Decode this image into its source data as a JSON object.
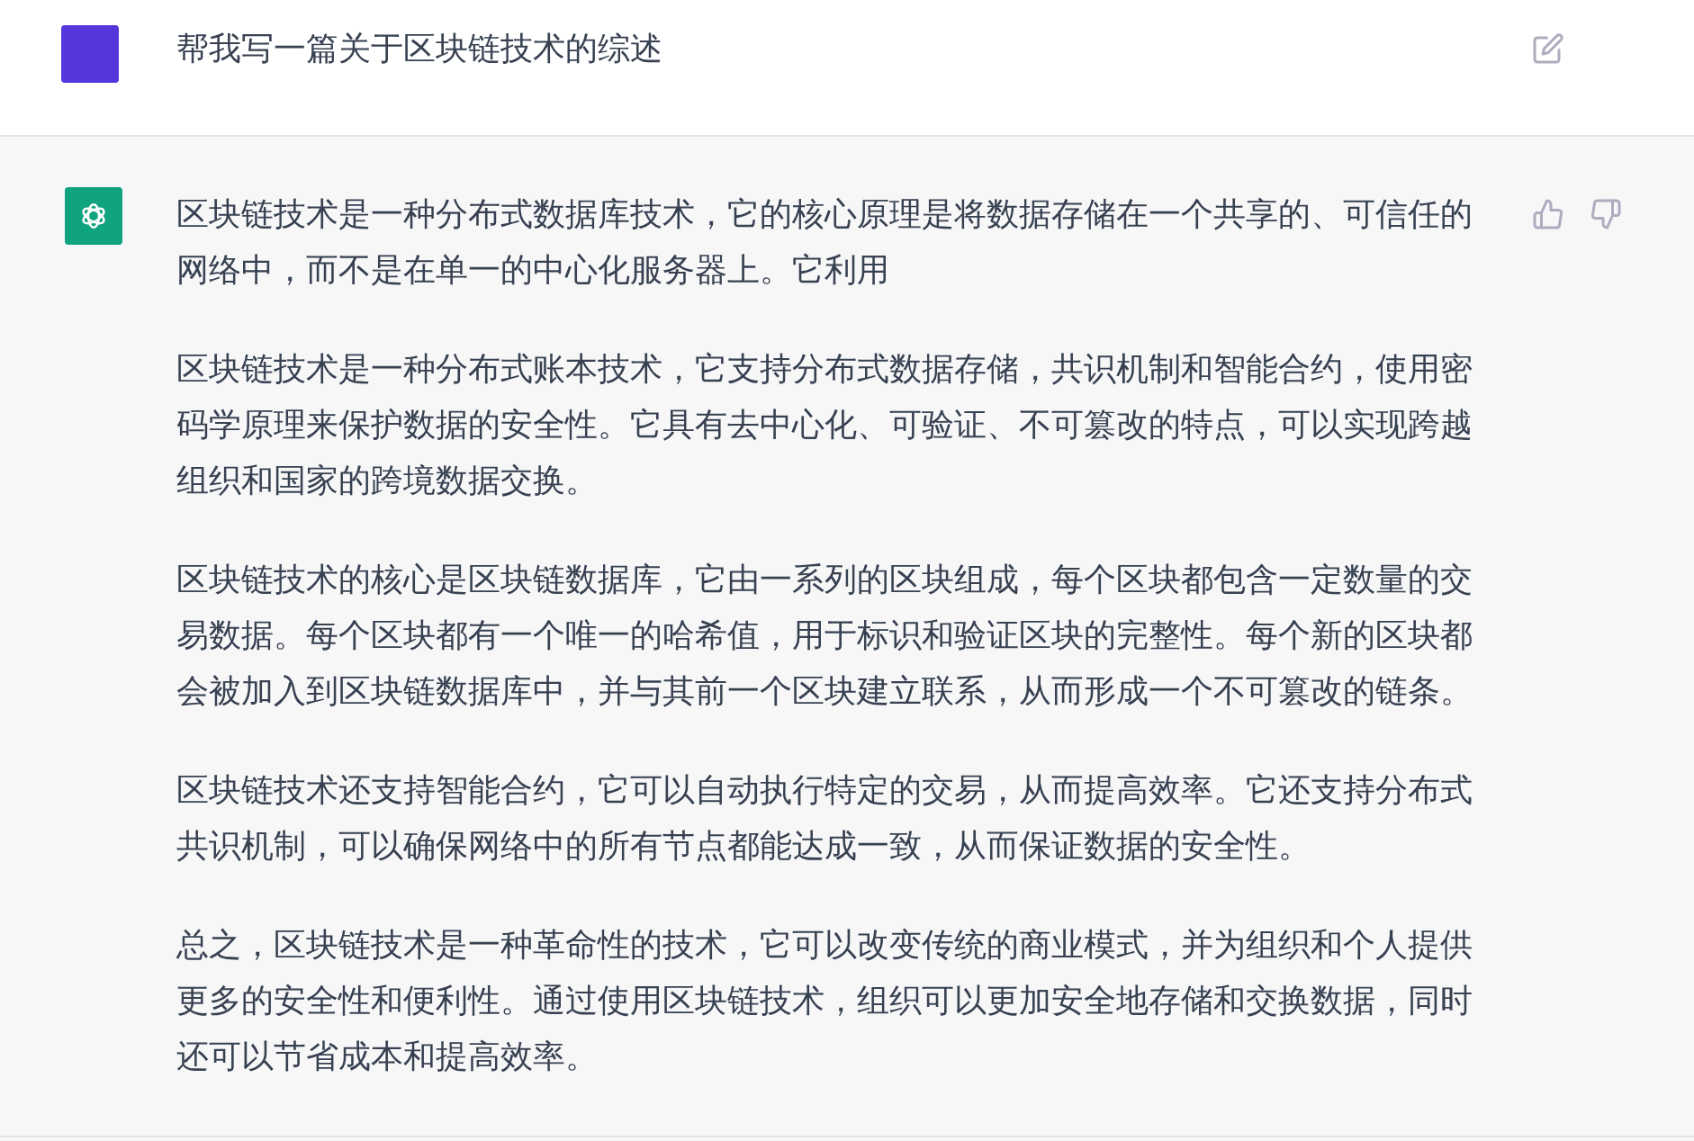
{
  "messages": [
    {
      "kind": "user",
      "paragraphs": [
        "帮我写一篇关于区块链技术的综述"
      ]
    },
    {
      "kind": "assistant",
      "paragraphs": [
        "区块链技术是一种分布式数据库技术，它的核心原理是将数据存储在一个共享的、可信任的网络中，而不是在单一的中心化服务器上。它利用",
        "区块链技术是一种分布式账本技术，它支持分布式数据存储，共识机制和智能合约，使用密码学原理来保护数据的安全性。它具有去中心化、可验证、不可篡改的特点，可以实现跨越组织和国家的跨境数据交换。",
        "区块链技术的核心是区块链数据库，它由一系列的区块组成，每个区块都包含一定数量的交易数据。每个区块都有一个唯一的哈希值，用于标识和验证区块的完整性。每个新的区块都会被加入到区块链数据库中，并与其前一个区块建立联系，从而形成一个不可篡改的链条。",
        "区块链技术还支持智能合约，它可以自动执行特定的交易，从而提高效率。它还支持分布式共识机制，可以确保网络中的所有节点都能达成一致，从而保证数据的安全性。",
        "总之，区块链技术是一种革命性的技术，它可以改变传统的商业模式，并为组织和个人提供更多的安全性和便利性。通过使用区块链技术，组织可以更加安全地存储和交换数据，同时还可以节省成本和提高效率。"
      ]
    }
  ]
}
